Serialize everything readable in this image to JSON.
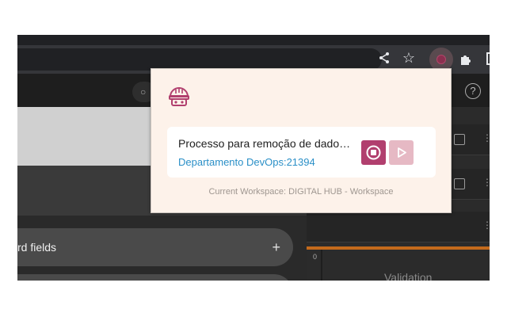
{
  "browser": {
    "toolbar_icons": [
      "share-icon",
      "star-icon",
      "extension-active-icon",
      "puzzle-icon",
      "side-panel-icon"
    ]
  },
  "app": {
    "search_icon": "search-icon",
    "help_symbol": "?",
    "left_panel": {
      "field_button_label": "rd fields",
      "field_button_plus": "+"
    },
    "right_panel": {
      "axis_zero": "0",
      "validation_label": "Validation"
    }
  },
  "popup": {
    "logo_icon": "robot-helmet-icon",
    "process": {
      "title": "Processo para remoção de dado…",
      "link": "Departamento DevOps:21394"
    },
    "stop_icon": "stop-icon",
    "play_icon": "play-icon",
    "workspace": "Current Workspace: DIGITAL HUB - Workspace",
    "colors": {
      "accent": "#b13f6e",
      "accent_light": "#e6b9c4",
      "link": "#2a8fc7",
      "background": "#fdf2ea"
    }
  }
}
